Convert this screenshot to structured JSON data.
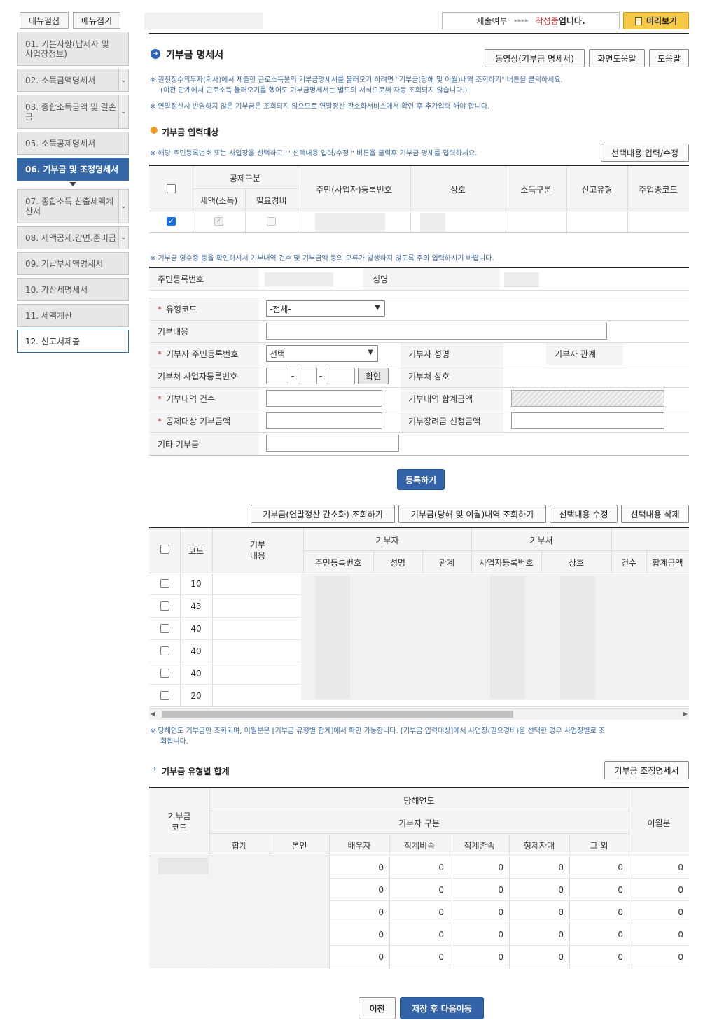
{
  "sidebar": {
    "expand_label": "메뉴펼침",
    "collapse_label": "메뉴접기",
    "items": [
      {
        "label": "01. 기본사항(납세자 및 사업장정보)"
      },
      {
        "label": "02. 소득금액명세서"
      },
      {
        "label": "03. 종합소득금액 및 결손금"
      },
      {
        "label": "05. 소득공제명세서"
      },
      {
        "label": "06. 기부금 및 조정명세서"
      },
      {
        "label": "07. 종합소득 산출세액계산서"
      },
      {
        "label": "08. 세액공제.감면.준비금"
      },
      {
        "label": "09. 기납부세액명세서"
      },
      {
        "label": "10. 가산세명세서"
      },
      {
        "label": "11. 세액계산"
      },
      {
        "label": "12. 신고서제출"
      }
    ]
  },
  "status": {
    "label": "제출여부",
    "arrows": "▸▸▸▸",
    "state": "작성중",
    "suffix": "입니다."
  },
  "preview_label": "미리보기",
  "page_title": "기부금 명세서",
  "header_buttons": {
    "video": "동영상(기부금 명세서)",
    "screen_help": "화면도움말",
    "help": "도움말"
  },
  "notes": {
    "n1a": "※ 원천징수의무자(회사)에서 제출한 근로소득분의 기부금명세서를 불러오기 하려면 \"기부금(당해 및 이월)내역 조회하기\" 버튼을 클릭하세요.",
    "n1b": "(이전 단계에서 근로소득 불러오기를 했어도 기부금명세서는 별도의 서식으로써 자동 조회되지 않습니다.)",
    "n2": "※ 연말정산시 반영하지 않은 기부금은 조회되지 않으므로 연말정산 간소화서비스에서 확인 후 추가입력 해야 합니다.",
    "n3": "※ 해당 주민등록번호 또는 사업장을 선택하고, \" 선택내용 입력/수정 \" 버튼을 클릭후 기부금 명세를 입력하세요.",
    "n4": "※ 기부금 영수증 등을 확인하셔서 기부내역 건수 및 기부금액 등의 오류가 발생하지 않도록 주의 입력하시기 바랍니다.",
    "n5a": "※ 당해연도 기부금만 조회되며, 이월분은 [기부금 유형별 합계]에서 확인 가능합니다. [기부금 입력대상]에서 사업장(필요경비)을 선택한 경우 사업장별로 조",
    "n5b": "회됩니다."
  },
  "target_section": {
    "title": "기부금 입력대상",
    "edit_button": "선택내용 입력/수정",
    "headers": {
      "deduction": "공제구분",
      "tax": "세액(소득)",
      "expense": "필요경비",
      "reg_no": "주민(사업자)등록번호",
      "company": "상호",
      "income_type": "소득구분",
      "report_type": "신고유형",
      "biz_code": "주업종코드"
    }
  },
  "form": {
    "resident_no_label": "주민등록번호",
    "name_label": "성명",
    "type_code_label": "유형코드",
    "type_code_value": "-전체-",
    "content_label": "기부내용",
    "donor_id_label": "기부자 주민등록번호",
    "donor_id_value": "선택",
    "donor_name_label": "기부자 성명",
    "donor_relation_label": "기부자 관계",
    "biz_no_label": "기부처 사업자등록번호",
    "confirm_button": "확인",
    "org_name_label": "기부처 상호",
    "count_label": "기부내역 건수",
    "total_label": "기부내역 합계금액",
    "deduct_amount_label": "공제대상 기부금액",
    "incentive_label": "기부장려금 신청금액",
    "other_label": "기타 기부금",
    "dash": "-",
    "register_button": "등록하기"
  },
  "list_buttons": {
    "query_simple": "기부금(연말정산 간소화) 조회하기",
    "query_year": "기부금(당해 및 이월)내역 조회하기",
    "edit": "선택내용 수정",
    "delete": "선택내용 삭제"
  },
  "list_table": {
    "headers": {
      "code": "코드",
      "content": "기부\n내용",
      "donor": "기부자",
      "donee": "기부처",
      "resident_no": "주민등록번호",
      "name": "성명",
      "relation": "관계",
      "biz_no": "사업자등록번호",
      "company": "상호",
      "count": "건수",
      "total": "합계금액"
    },
    "rows": [
      {
        "code": "10"
      },
      {
        "code": "43"
      },
      {
        "code": "40"
      },
      {
        "code": "40"
      },
      {
        "code": "40"
      },
      {
        "code": "20"
      }
    ]
  },
  "summary_section": {
    "title": "기부금 유형별 합계",
    "adjust_button": "기부금 조정명세서",
    "headers": {
      "code": "기부금\n코드",
      "current_year": "당해연도",
      "donor_type": "기부자 구분",
      "carryover": "이월분",
      "total": "합계",
      "self": "본인",
      "spouse": "배우자",
      "descendant": "직계비속",
      "ascendant": "직계존속",
      "sibling": "형제자매",
      "other": "그 외"
    },
    "rows": [
      {
        "spouse": "0",
        "descendant": "0",
        "ascendant": "0",
        "sibling": "0",
        "other": "0",
        "carryover": "0"
      },
      {
        "spouse": "0",
        "descendant": "0",
        "ascendant": "0",
        "sibling": "0",
        "other": "0",
        "carryover": "0"
      },
      {
        "spouse": "0",
        "descendant": "0",
        "ascendant": "0",
        "sibling": "0",
        "other": "0",
        "carryover": "0"
      },
      {
        "spouse": "0",
        "descendant": "0",
        "ascendant": "0",
        "sibling": "0",
        "other": "0",
        "carryover": "0"
      },
      {
        "spouse": "0",
        "descendant": "0",
        "ascendant": "0",
        "sibling": "0",
        "other": "0",
        "carryover": "0"
      }
    ]
  },
  "footer": {
    "prev_button": "이전",
    "save_next_button": "저장 후 다음이동"
  },
  "colors": {
    "accent": "#3466a8",
    "status_red": "#c41e1e",
    "preview_bg": "#f7c948",
    "note_blue": "#3b6aa0"
  }
}
